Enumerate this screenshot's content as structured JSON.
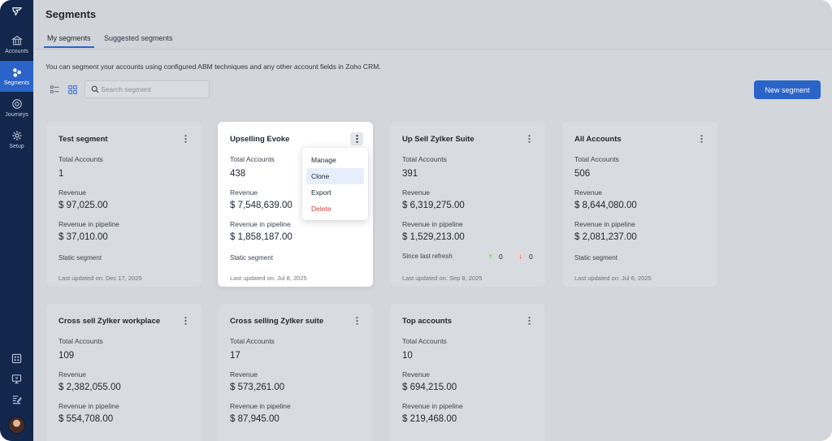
{
  "sidebar": {
    "items": [
      {
        "label": "Accounts",
        "icon": "bank-icon"
      },
      {
        "label": "Segments",
        "icon": "segments-icon",
        "active": true
      },
      {
        "label": "Journeys",
        "icon": "journey-icon"
      },
      {
        "label": "Setup",
        "icon": "gear-icon"
      }
    ],
    "bottom_icons": [
      "apps-grid-icon",
      "presentation-icon",
      "notes-icon"
    ]
  },
  "header": {
    "title": "Segments",
    "tabs": [
      {
        "label": "My segments",
        "active": true
      },
      {
        "label": "Suggested segments",
        "active": false
      }
    ]
  },
  "description": "You can segment your accounts using configured ABM techniques and any other account fields in Zoho CRM.",
  "toolbar": {
    "view_modes": [
      "list-view-icon",
      "grid-view-icon"
    ],
    "active_view": "grid",
    "search_placeholder": "Search segment",
    "new_button_label": "New segment"
  },
  "card_labels": {
    "total_accounts": "Total Accounts",
    "revenue": "Revenue",
    "revenue_pipeline": "Revenue in pipeline"
  },
  "segments": [
    {
      "name": "Test segment",
      "total_accounts": "1",
      "revenue": "$ 97,025.00",
      "revenue_pipeline": "$ 37,010.00",
      "type": "Static segment",
      "updated": "Last updated on: Dec 17, 2025"
    },
    {
      "name": "Upselling Evoke",
      "total_accounts": "438",
      "revenue": "$ 7,548,639.00",
      "revenue_pipeline": "$ 1,858,187.00",
      "type": "Static segment",
      "updated": "Last updated on: Jul 8, 2025"
    },
    {
      "name": "Up Sell Zylker Suite",
      "total_accounts": "391",
      "revenue": "$ 6,319,275.00",
      "revenue_pipeline": "$ 1,529,213.00",
      "since_label": "Since last refresh",
      "up_count": "0",
      "down_count": "0",
      "updated": "Last updated on: Sep 8, 2025"
    },
    {
      "name": "All Accounts",
      "total_accounts": "506",
      "revenue": "$ 8,644,080.00",
      "revenue_pipeline": "$ 2,081,237.00",
      "type": "Static segment",
      "updated": "Last updated on: Jul 6, 2025"
    },
    {
      "name": "Cross sell Zylker workplace",
      "total_accounts": "109",
      "revenue": "$ 2,382,055.00",
      "revenue_pipeline": "$ 554,708.00"
    },
    {
      "name": "Cross selling Zylker suite",
      "total_accounts": "17",
      "revenue": "$ 573,261.00",
      "revenue_pipeline": "$ 87,945.00"
    },
    {
      "name": "Top accounts",
      "total_accounts": "10",
      "revenue": "$ 694,215.00",
      "revenue_pipeline": "$ 219,468.00"
    }
  ],
  "context_menu": {
    "items": [
      "Manage",
      "Clone",
      "Export",
      "Delete"
    ],
    "highlighted": "Clone"
  },
  "colors": {
    "sidebar": "#13264b",
    "accent": "#2a64c8",
    "danger": "#d63b3b"
  }
}
